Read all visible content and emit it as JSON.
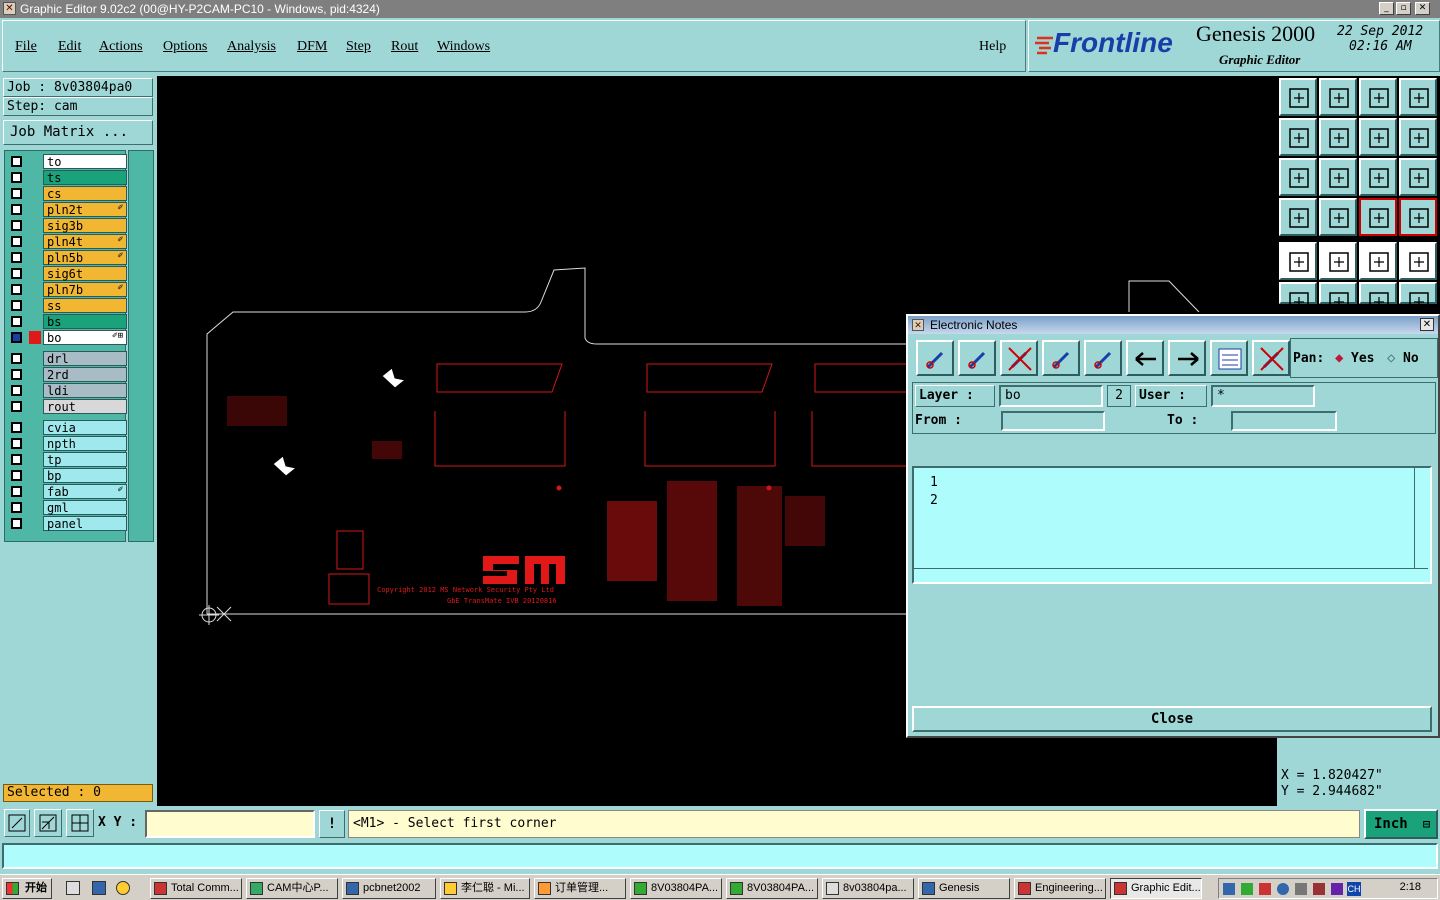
{
  "window": {
    "title": "Graphic Editor 9.02c2 (00@HY-P2CAM-PC10 - Windows, pid:4324)"
  },
  "menu": [
    "File",
    "Edit",
    "Actions",
    "Options",
    "Analysis",
    "DFM",
    "Step",
    "Rout",
    "Windows"
  ],
  "help_label": "Help",
  "brand": {
    "logo": "Frontline",
    "product": "Genesis 2000",
    "subtitle": "Graphic Editor",
    "date": "22 Sep 2012",
    "time": "02:16 AM"
  },
  "job": {
    "job_text": "Job : 8v03804pa0",
    "step_text": "Step: cam",
    "matrix_button": "Job Matrix ..."
  },
  "layers_group1": [
    {
      "name": "to",
      "color": "#ffffff",
      "mark": ""
    },
    {
      "name": "ts",
      "color": "#1aa37a",
      "mark": ""
    },
    {
      "name": "cs",
      "color": "#f2b732",
      "mark": ""
    },
    {
      "name": "pln2t",
      "color": "#f2b732",
      "mark": "✐"
    },
    {
      "name": "sig3b",
      "color": "#f2b732",
      "mark": ""
    },
    {
      "name": "pln4t",
      "color": "#f2b732",
      "mark": "✐"
    },
    {
      "name": "pln5b",
      "color": "#f2b732",
      "mark": "✐"
    },
    {
      "name": "sig6t",
      "color": "#f2b732",
      "mark": ""
    },
    {
      "name": "pln7b",
      "color": "#f2b732",
      "mark": "✐"
    },
    {
      "name": "ss",
      "color": "#f2b732",
      "mark": ""
    },
    {
      "name": "bs",
      "color": "#1aa37a",
      "mark": ""
    },
    {
      "name": "bo",
      "color": "#ffffff",
      "mark": "✐⊞"
    }
  ],
  "layers_group2": [
    {
      "name": "drl",
      "color": "#a7bcc4"
    },
    {
      "name": "2rd",
      "color": "#a7bcc4"
    },
    {
      "name": "ldi",
      "color": "#a7bcc4"
    },
    {
      "name": "rout",
      "color": "#d8d8d8"
    }
  ],
  "layers_group3": [
    {
      "name": "cvia",
      "color": "#9ee8ee",
      "mark": ""
    },
    {
      "name": "npth",
      "color": "#9ee8ee",
      "mark": ""
    },
    {
      "name": "tp",
      "color": "#9ee8ee",
      "mark": ""
    },
    {
      "name": "bp",
      "color": "#9ee8ee",
      "mark": ""
    },
    {
      "name": "fab",
      "color": "#9ee8ee",
      "mark": "✐"
    },
    {
      "name": "gml",
      "color": "#9ee8ee",
      "mark": ""
    },
    {
      "name": "panel",
      "color": "#9ee8ee",
      "mark": ""
    }
  ],
  "selected_text": "Selected : 0",
  "notes": {
    "title": "Electronic Notes",
    "pan_label": "Pan:",
    "pan_yes": "Yes",
    "pan_no": "No",
    "layer_label": "Layer :",
    "layer_value": "bo",
    "layer_num": "2",
    "user_label": "User :",
    "user_value": "*",
    "from_label": "From :",
    "to_label": "To :",
    "lines": [
      "1",
      "2"
    ],
    "close_label": "Close"
  },
  "board_text": {
    "copyright_line1": "Copyright 2012 MS Network Security Pty Ltd",
    "copyright_line2": "GbE TransMate IVB 20120816",
    "logo": "SM"
  },
  "coords": {
    "x": "X = 1.820427\"",
    "y": "Y = 2.944682\""
  },
  "status": {
    "xy_label": "X Y :",
    "prompt": "<M1> - Select first corner",
    "unit": "Inch",
    "bang": "!"
  },
  "taskbar": {
    "start": "开始",
    "tasks": [
      "Total Comm...",
      "CAM中心P...",
      "pcbnet2002",
      "李仁聪 - Mi...",
      "订单管理...",
      "8V03804PA...",
      "8V03804PA...",
      "8v03804pa...",
      "Genesis",
      "Engineering...",
      "Graphic Edit..."
    ],
    "clock": "2:18"
  }
}
